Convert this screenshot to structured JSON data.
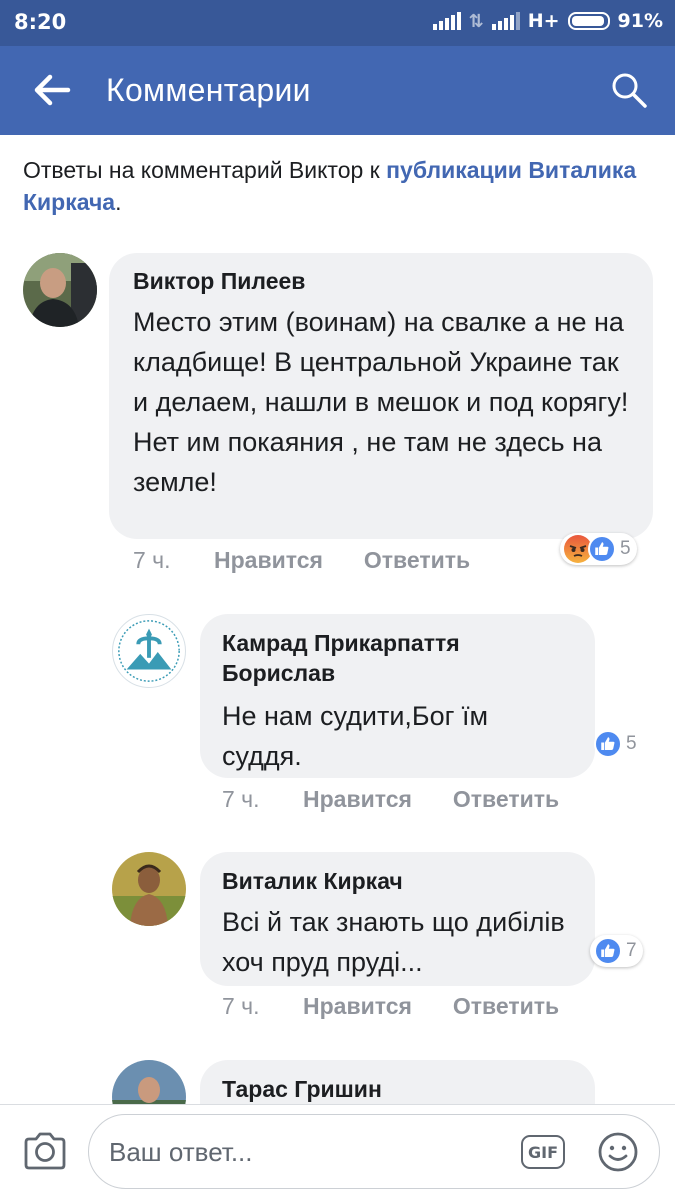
{
  "status": {
    "time": "8:20",
    "network": "H+",
    "battery": "91%"
  },
  "appbar": {
    "title": "Комментарии"
  },
  "context": {
    "prefix": "Ответы на комментарий Виктор к ",
    "link": "публикации Виталика Киркача",
    "suffix": "."
  },
  "comments": [
    {
      "author": "Виктор Пилеев",
      "text": "Место этим (воинам) на свалке а не на кладбище! В центральной Украине так и делаем, нашли в мешок и под корягу! Нет им покаяния , не там не здесь на земле!",
      "time": "7 ч.",
      "like_label": "Нравится",
      "reply_label": "Ответить",
      "reactions": [
        "angry-icon",
        "like-icon"
      ],
      "reaction_count": "5"
    },
    {
      "author": "Камрад Прикарпаття Борислав",
      "text": "Не нам судити,Бог їм суддя.",
      "time": "7 ч.",
      "like_label": "Нравится",
      "reply_label": "Ответить",
      "reactions": [
        "like-icon"
      ],
      "reaction_count": "5"
    },
    {
      "author": "Виталик Киркач",
      "text": "Всі й так знають що дибілів хоч пруд пруді...",
      "time": "7 ч.",
      "like_label": "Нравится",
      "reply_label": "Ответить",
      "reactions": [
        "like-icon"
      ],
      "reaction_count": "7"
    },
    {
      "author": "Тарас Гришин"
    }
  ],
  "composer": {
    "placeholder": "Ваш ответ...",
    "gif_label": "GIF"
  },
  "colors": {
    "appbar": "#4267b2",
    "statusbar": "#385898",
    "link": "#4267b2",
    "bubble": "#f0f1f3",
    "meta": "#90949c"
  }
}
